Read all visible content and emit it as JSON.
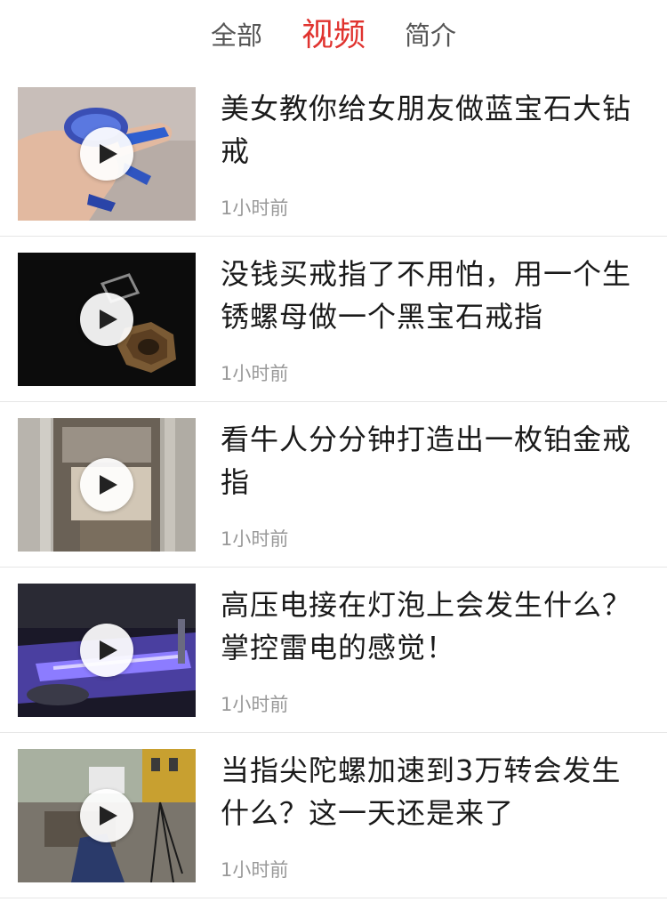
{
  "tabs": [
    {
      "label": "全部"
    },
    {
      "label": "视频"
    },
    {
      "label": "简介"
    }
  ],
  "videos": [
    {
      "title": "美女教你给女朋友做蓝宝石大钻戒",
      "time": "1小时前"
    },
    {
      "title": "没钱买戒指了不用怕，用一个生锈螺母做一个黑宝石戒指",
      "time": "1小时前"
    },
    {
      "title": "看牛人分分钟打造出一枚铂金戒指",
      "time": "1小时前"
    },
    {
      "title": "高压电接在灯泡上会发生什么？掌控雷电的感觉！",
      "time": "1小时前"
    },
    {
      "title": "当指尖陀螺加速到3万转会发生什么？这一天还是来了",
      "time": "1小时前"
    }
  ],
  "colors": {
    "accent": "#e0332f",
    "tab_text": "#555555",
    "time_text": "#999999",
    "divider": "#e6e6e6"
  },
  "icons": {
    "play": "play-icon"
  }
}
